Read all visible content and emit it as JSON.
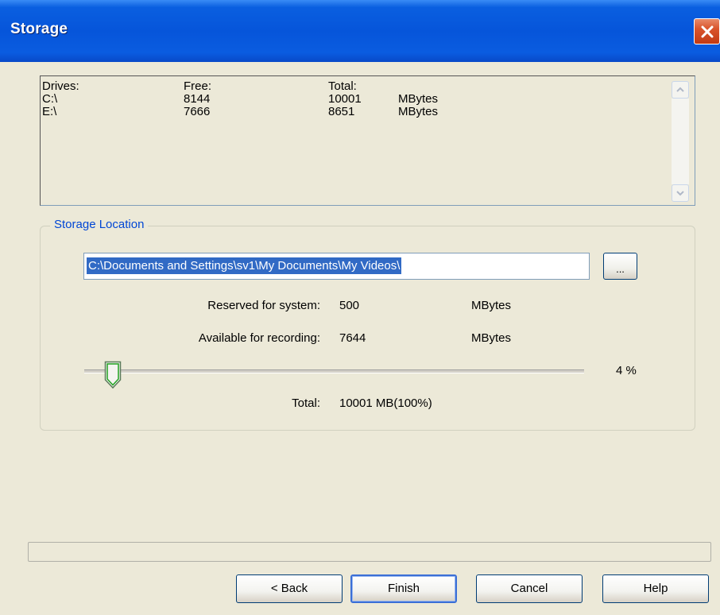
{
  "window": {
    "title": "Storage"
  },
  "drives": {
    "header": {
      "drive": "Drives:",
      "free": "Free:",
      "total": "Total:"
    },
    "rows": [
      {
        "drive": "C:\\",
        "free": "8144",
        "total": "10001",
        "unit": "MBytes"
      },
      {
        "drive": "E:\\",
        "free": "7666",
        "total": "8651",
        "unit": "MBytes"
      }
    ]
  },
  "storage": {
    "group_label": "Storage Location",
    "path": "C:\\Documents and Settings\\sv1\\My Documents\\My Videos\\",
    "browse_label": "...",
    "reserved_label": "Reserved for system:",
    "reserved_value": "500",
    "reserved_unit": "MBytes",
    "available_label": "Available for recording:",
    "available_value": "7644",
    "available_unit": "MBytes",
    "slider_percent_text": "4 %",
    "slider_percent": 4,
    "total_label": "Total:",
    "total_value": "10001 MB(100%)"
  },
  "buttons": {
    "back": "< Back",
    "finish": "Finish",
    "cancel": "Cancel",
    "help": "Help"
  },
  "colors": {
    "titlebar": "#0655da",
    "close": "#d9542c",
    "selection": "#316ac5",
    "group_label": "#0046d5"
  }
}
